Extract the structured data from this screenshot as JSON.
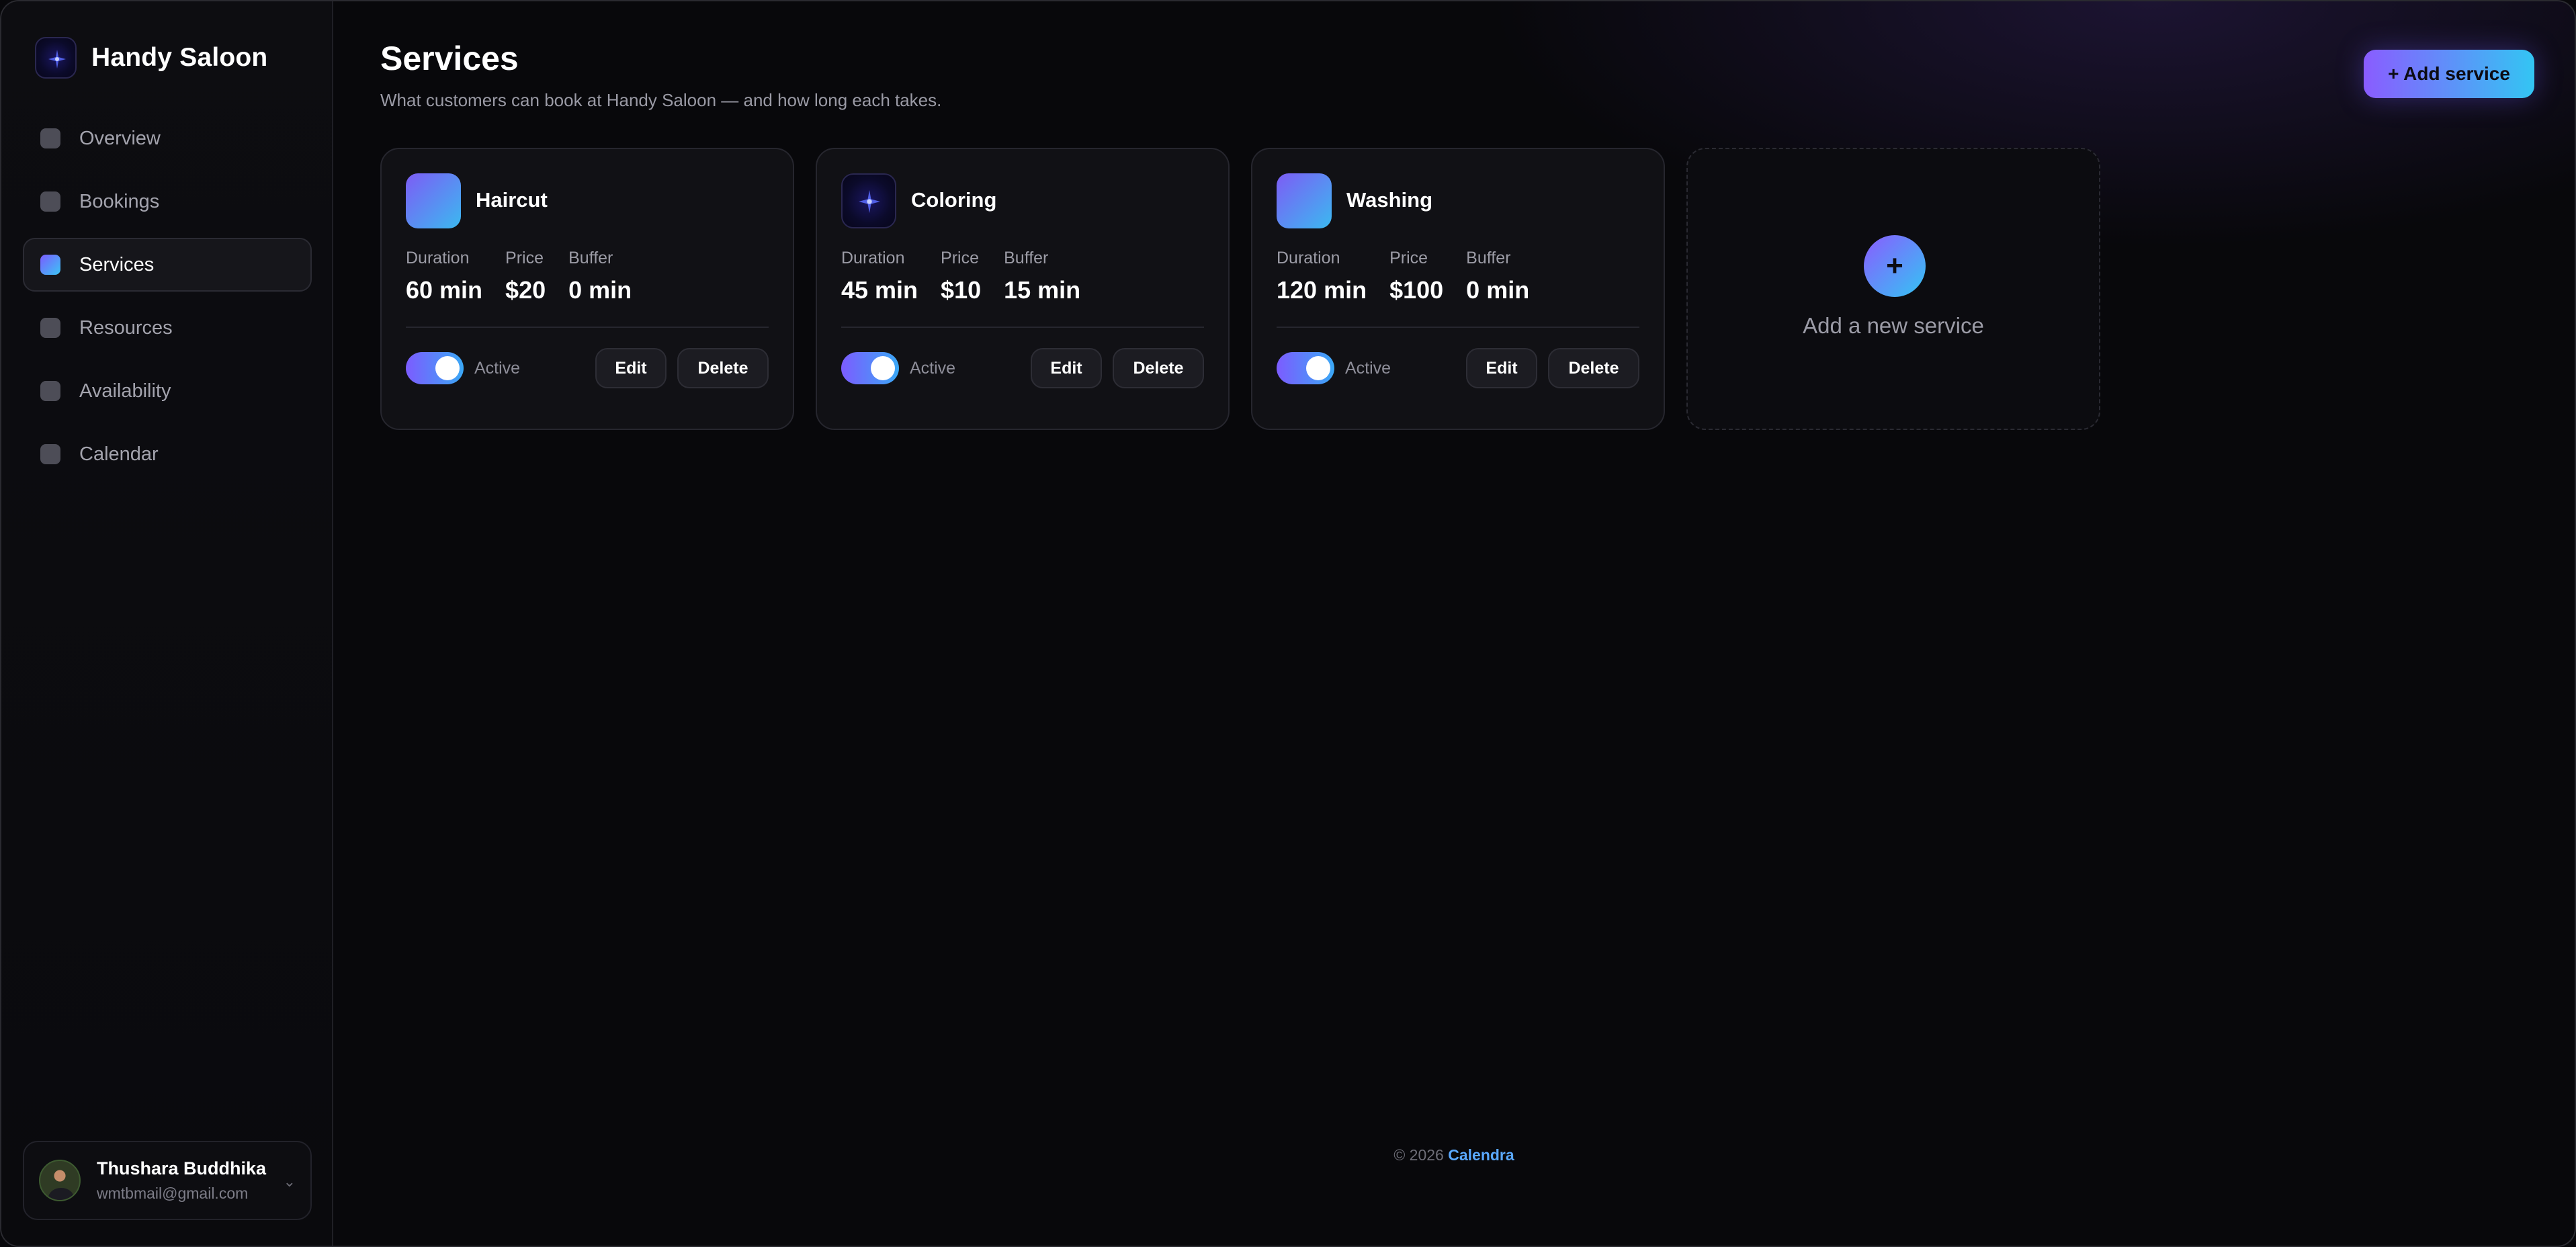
{
  "app": {
    "brand_name": "Handy Saloon",
    "brand_icon": "sparkle-logo-icon",
    "accent_gradient": [
      "#8a5cff",
      "#33c5f3"
    ],
    "background": "#08080b"
  },
  "sidebar": {
    "items": [
      {
        "label": "Overview",
        "active": false
      },
      {
        "label": "Bookings",
        "active": false
      },
      {
        "label": "Services",
        "active": true
      },
      {
        "label": "Resources",
        "active": false
      },
      {
        "label": "Availability",
        "active": false
      },
      {
        "label": "Calendar",
        "active": false
      }
    ],
    "user": {
      "name": "Thushara Buddhika",
      "email": "wmtbmail@gmail.com",
      "chevron": "⌄"
    }
  },
  "header": {
    "title": "Services",
    "subtitle": "What customers can book at Handy Saloon — and how long each takes.",
    "add_button": "+ Add service"
  },
  "services": [
    {
      "name": "Haircut",
      "icon_style": "gradient",
      "duration_label": "Duration",
      "duration": "60 min",
      "price_label": "Price",
      "price": "$20",
      "buffer_label": "Buffer",
      "buffer": "0 min",
      "active": true,
      "status_label": "Active",
      "edit_label": "Edit",
      "delete_label": "Delete"
    },
    {
      "name": "Coloring",
      "icon_style": "sparkle",
      "duration_label": "Duration",
      "duration": "45 min",
      "price_label": "Price",
      "price": "$10",
      "buffer_label": "Buffer",
      "buffer": "15 min",
      "active": true,
      "status_label": "Active",
      "edit_label": "Edit",
      "delete_label": "Delete"
    },
    {
      "name": "Washing",
      "icon_style": "gradient",
      "duration_label": "Duration",
      "duration": "120 min",
      "price_label": "Price",
      "price": "$100",
      "buffer_label": "Buffer",
      "buffer": "0 min",
      "active": true,
      "status_label": "Active",
      "edit_label": "Edit",
      "delete_label": "Delete"
    }
  ],
  "new_service": {
    "plus": "+",
    "label": "Add a new service"
  },
  "footer": {
    "copyright": "© 2026",
    "link": "Calendra"
  }
}
